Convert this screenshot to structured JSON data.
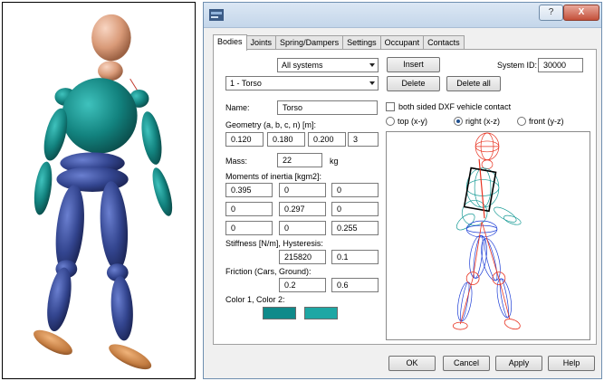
{
  "colors": {
    "accent_teal": "#16827f",
    "color1": "#0f8a8a",
    "color2": "#1ea7a4",
    "body_blue": "#34468f",
    "head_tan": "#d9a080",
    "feet_brown": "#c8844a",
    "wire_red": "#e8311f",
    "wire_blue": "#1b3cd6",
    "wire_teal": "#169a95"
  },
  "titlebar": {
    "icon": "app-window-icon",
    "help_label": "?",
    "close_label": "X"
  },
  "tabs": [
    {
      "label": "Bodies",
      "active": true
    },
    {
      "label": "Joints",
      "active": false
    },
    {
      "label": "Spring/Dampers",
      "active": false
    },
    {
      "label": "Settings",
      "active": false
    },
    {
      "label": "Occupant",
      "active": false
    },
    {
      "label": "Contacts",
      "active": false
    }
  ],
  "bodies": {
    "system_filter": "All systems",
    "selected_body": "1 - Torso",
    "insert_label": "Insert",
    "delete_label": "Delete",
    "delete_all_label": "Delete all",
    "system_id_label": "System ID:",
    "system_id_value": "30000",
    "name_label": "Name:",
    "name_value": "Torso",
    "dxf_label": "both sided DXF vehicle contact",
    "dxf_checked": false,
    "geometry_label": "Geometry (a, b, c, n) [m]:",
    "geometry": [
      "0.120",
      "0.180",
      "0.200",
      "3"
    ],
    "mass_label": "Mass:",
    "mass_value": "22",
    "mass_unit": "kg",
    "inertia_label": "Moments of inertia [kgm2]:",
    "inertia": [
      [
        "0.395",
        "0",
        "0"
      ],
      [
        "0",
        "0.297",
        "0"
      ],
      [
        "0",
        "0",
        "0.255"
      ]
    ],
    "stiffness_label": "Stiffness [N/m], Hysteresis:",
    "stiffness_value": "215820",
    "hysteresis_value": "0.1",
    "friction_label": "Friction (Cars, Ground):",
    "friction_cars": "0.2",
    "friction_ground": "0.6",
    "color_label": "Color 1, Color 2:",
    "view_options": [
      {
        "label": "top (x-y)",
        "selected": false
      },
      {
        "label": "right (x-z)",
        "selected": true
      },
      {
        "label": "front (y-z)",
        "selected": false
      }
    ]
  },
  "footer": {
    "ok_label": "OK",
    "cancel_label": "Cancel",
    "apply_label": "Apply",
    "help_label": "Help"
  }
}
